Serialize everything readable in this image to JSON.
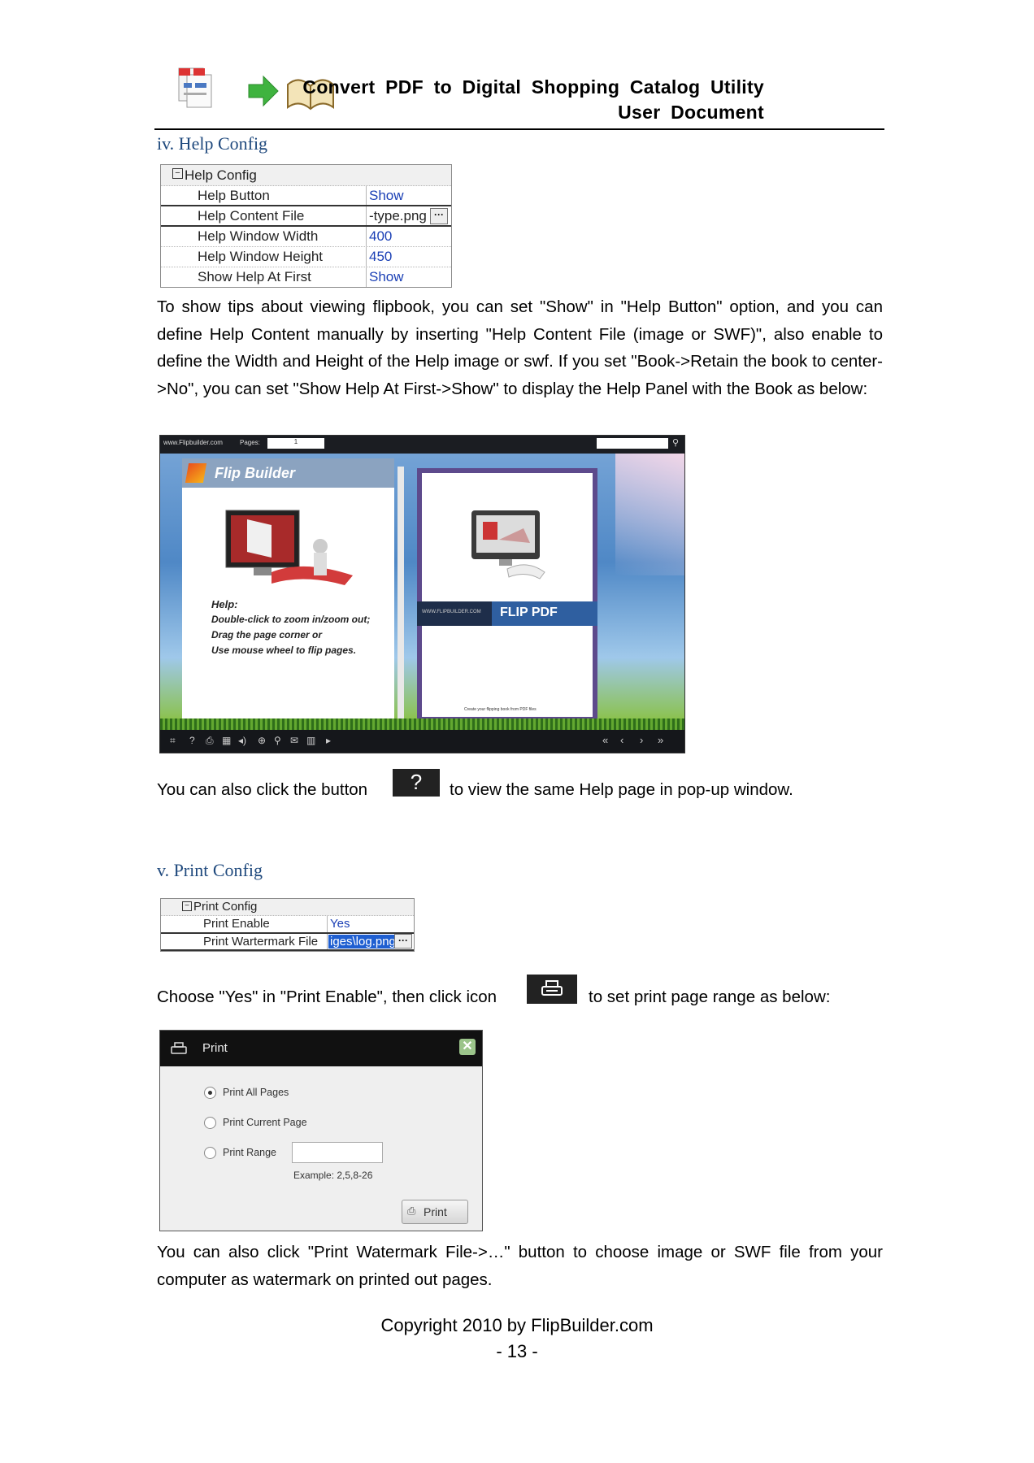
{
  "header": {
    "title_line1": "Convert PDF to Digital Shopping Catalog Utility",
    "title_line2": "User Document",
    "logo_icons": [
      "pdf-files-icon",
      "green-arrow-icon",
      "open-book-icon"
    ]
  },
  "help_section": {
    "heading": "iv. Help Config",
    "grid": {
      "group": "Help Config",
      "rows": [
        {
          "key": "Help Button",
          "value": "Show"
        },
        {
          "key": "Help Content File",
          "value": "-type.png"
        },
        {
          "key": "Help Window Width",
          "value": "400"
        },
        {
          "key": "Help Window Height",
          "value": "450"
        },
        {
          "key": "Show Help At First",
          "value": "Show"
        }
      ]
    },
    "paragraph": "To show tips about viewing flipbook, you can set \"Show\" in \"Help Button\" option, and you can define Help Content manually by inserting \"Help Content File (image or SWF)\", also enable to define the Width and Height of the Help image or swf. If you set \"Book->Retain the book to center->No\", you can set \"Show Help At First->Show\" to display the Help Panel with the Book as below:",
    "screenshot": {
      "site": "www.Flipbuilder.com",
      "pages_label": "Pages:",
      "pages_value": "1",
      "help_panel_title": "Flip Builder",
      "help_heading": "Help:",
      "help_lines": [
        "Double-click to zoom in/zoom out;",
        "Drag the page corner or",
        "Use mouse wheel to flip pages."
      ],
      "book_site": "WWW.FLIPBUILDER.COM",
      "book_brand": "FLIP PDF",
      "book_caption": "Create your flipping book from PDF files"
    },
    "button_line_before": "You can also click the button",
    "button_line_after": "to view the same Help page in pop-up window.",
    "help_button_glyph": "?"
  },
  "print_section": {
    "heading": "v. Print Config",
    "grid": {
      "group": "Print Config",
      "rows": [
        {
          "key": "Print Enable",
          "value": "Yes"
        },
        {
          "key": "Print Wartermark File",
          "value": "iges\\log.png"
        }
      ]
    },
    "line_before": "Choose \"Yes\" in \"Print Enable\", then click icon",
    "line_after": "to set print page range as below:",
    "dialog": {
      "title": "Print",
      "options": [
        "Print All Pages",
        "Print Current Page",
        "Print Range"
      ],
      "example": "Example: 2,5,8-26",
      "button": "Print"
    },
    "closing": "You can also click \"Print Watermark File->…\" button to choose image or SWF file from your computer as watermark on printed out pages."
  },
  "footer": {
    "copyright": "Copyright 2010 by FlipBuilder.com",
    "page_number": "- 13 -"
  }
}
